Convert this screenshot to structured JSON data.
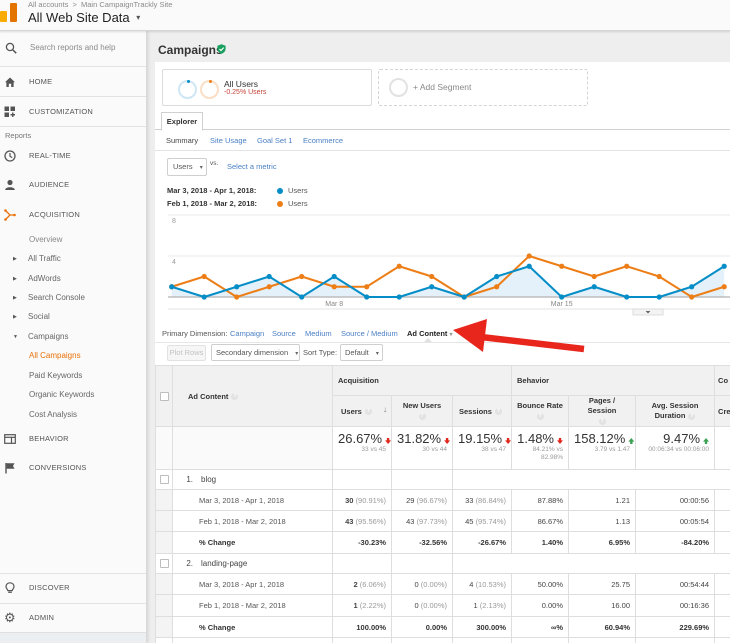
{
  "header": {
    "breadcrumb_account": "All accounts",
    "breadcrumb_separator": ">",
    "breadcrumb_property": "Main CampaignTrackly Site",
    "view_name": "All Web Site Data",
    "view_caret": "▾"
  },
  "sidebar": {
    "search_placeholder": "Search reports and help",
    "home": "HOME",
    "customization": "CUSTOMIZATION",
    "reports_heading": "Reports",
    "realtime": "REAL-TIME",
    "audience": "AUDIENCE",
    "acquisition": "ACQUISITION",
    "acquisition_items": [
      "Overview",
      "All Traffic",
      "AdWords",
      "Search Console",
      "Social",
      "Campaigns"
    ],
    "campaign_items": [
      "All Campaigns",
      "Paid Keywords",
      "Organic Keywords",
      "Cost Analysis"
    ],
    "behavior": "BEHAVIOR",
    "conversions": "CONVERSIONS",
    "discover": "DISCOVER",
    "admin": "ADMIN",
    "active_item": "All Campaigns",
    "accent_color": "#e8710a",
    "expand_glyph": "▶",
    "collapse_glyph": "▼"
  },
  "page": {
    "title": "Campaigns",
    "verified_icon": "shield-check-icon"
  },
  "segments": {
    "active_name": "All Users",
    "active_detail": "-0.25% Users",
    "add_label": "+ Add Segment"
  },
  "explorer": {
    "tab": "Explorer",
    "subtabs": [
      "Summary",
      "Site Usage",
      "Goal Set 1",
      "Ecommerce"
    ],
    "active_subtab": "Summary"
  },
  "metric_picker": {
    "selected": "Users",
    "caret": "▾",
    "vs_label": "vs.",
    "select_metric": "Select a metric"
  },
  "legend": [
    {
      "range": "Mar 3, 2018 - Apr 1, 2018:",
      "metric": "Users",
      "color": "#058dc7"
    },
    {
      "range": "Feb 1, 2018 - Mar 2, 2018:",
      "metric": "Users",
      "color": "#ed7e17"
    }
  ],
  "chart_data": {
    "type": "line",
    "title": "",
    "xlabel": "",
    "ylabel": "",
    "x": [
      "Mar 3",
      "Mar 4",
      "Mar 5",
      "Mar 6",
      "Mar 7",
      "Mar 8",
      "Mar 9",
      "Mar 10",
      "Mar 11",
      "Mar 12",
      "Mar 13",
      "Mar 14",
      "Mar 15",
      "Mar 16",
      "Mar 17",
      "Mar 18",
      "Mar 19",
      "Mar 20"
    ],
    "x_ticks": [
      "Mar 8",
      "Mar 15"
    ],
    "y_ticks": [
      4,
      8
    ],
    "ylim": [
      0,
      8
    ],
    "grid": true,
    "legend": "top-left",
    "series": [
      {
        "name": "Users (Mar 3, 2018 - Apr 1, 2018)",
        "color": "#058dc7",
        "area": true,
        "values": [
          1,
          0,
          1,
          2,
          0,
          2,
          0,
          0,
          1,
          0,
          2,
          3,
          0,
          1,
          0,
          0,
          1,
          3
        ]
      },
      {
        "name": "Users (Feb 1, 2018 - Mar 2, 2018)",
        "color": "#ed7e17",
        "area": false,
        "values": [
          1,
          2,
          0,
          1,
          2,
          1,
          1,
          3,
          2,
          0,
          1,
          4,
          3,
          2,
          3,
          2,
          0,
          1
        ]
      }
    ]
  },
  "dimensions": {
    "label": "Primary Dimension:",
    "options": [
      "Campaign",
      "Source",
      "Medium",
      "Source / Medium"
    ],
    "active": "Ad Content",
    "active_caret": "▾"
  },
  "table_toolbar": {
    "plot_rows": "Plot Rows",
    "secondary_dimension": "Secondary dimension",
    "sort_type_label": "Sort Type:",
    "sort_type_value": "Default",
    "caret": "▾"
  },
  "table": {
    "headers": {
      "dimension": "Ad Content",
      "acquisition": "Acquisition",
      "behavior": "Behavior",
      "conversions_partial": "Co",
      "users": "Users",
      "new_users": "New Users",
      "sessions": "Sessions",
      "bounce_rate": "Bounce Rate",
      "pages_session": "Pages / Session",
      "avg_session_duration": "Avg. Session Duration",
      "conversions_sub_partial": "Cre",
      "help": "?",
      "sort_arrow": "↓"
    },
    "totals": [
      {
        "metric": "Users",
        "value": "26.67%",
        "trend": "down",
        "compare": "33 vs 45"
      },
      {
        "metric": "New Users",
        "value": "31.82%",
        "trend": "down",
        "compare": "30 vs 44"
      },
      {
        "metric": "Sessions",
        "value": "19.15%",
        "trend": "down",
        "compare": "38 vs 47"
      },
      {
        "metric": "Bounce Rate",
        "value": "1.48%",
        "trend": "down",
        "compare": "84.21% vs 82.98%"
      },
      {
        "metric": "Pages / Session",
        "value": "158.12%",
        "trend": "up",
        "compare": "3.79 vs 1.47"
      },
      {
        "metric": "Avg. Session Duration",
        "value": "9.47%",
        "trend": "up",
        "compare": "00:06:34 vs 00:06:00"
      }
    ],
    "trend_colors": {
      "down": "#e0281d",
      "up": "#3ba153"
    },
    "groups": [
      {
        "index": "1.",
        "name": "blog",
        "rows": [
          {
            "label": "Mar 3, 2018 - Apr 1, 2018",
            "users": "30",
            "users_pct": "(90.91%)",
            "new_users": "29",
            "new_users_pct": "(96.67%)",
            "sessions": "33",
            "sessions_pct": "(86.84%)",
            "bounce_rate": "87.88%",
            "pages_session": "1.21",
            "avg_session_duration": "00:00:56"
          },
          {
            "label": "Feb 1, 2018 - Mar 2, 2018",
            "users": "43",
            "users_pct": "(95.56%)",
            "new_users": "43",
            "new_users_pct": "(97.73%)",
            "sessions": "45",
            "sessions_pct": "(95.74%)",
            "bounce_rate": "86.67%",
            "pages_session": "1.13",
            "avg_session_duration": "00:05:54"
          },
          {
            "label": "% Change",
            "users": "-30.23%",
            "new_users": "-32.56%",
            "sessions": "-26.67%",
            "bounce_rate": "1.40%",
            "pages_session": "6.95%",
            "avg_session_duration": "-84.20%"
          }
        ]
      },
      {
        "index": "2.",
        "name": "landing-page",
        "rows": [
          {
            "label": "Mar 3, 2018 - Apr 1, 2018",
            "users": "2",
            "users_pct": "(6.06%)",
            "new_users": "0",
            "new_users_pct": "(0.00%)",
            "sessions": "4",
            "sessions_pct": "(10.53%)",
            "bounce_rate": "50.00%",
            "pages_session": "25.75",
            "avg_session_duration": "00:54:44"
          },
          {
            "label": "Feb 1, 2018 - Mar 2, 2018",
            "users": "1",
            "users_pct": "(2.22%)",
            "new_users": "0",
            "new_users_pct": "(0.00%)",
            "sessions": "1",
            "sessions_pct": "(2.13%)",
            "bounce_rate": "0.00%",
            "pages_session": "16.00",
            "avg_session_duration": "00:16:36"
          },
          {
            "label": "% Change",
            "users": "100.00%",
            "new_users": "0.00%",
            "sessions": "300.00%",
            "bounce_rate": "∞%",
            "pages_session": "60.94%",
            "avg_session_duration": "229.69%"
          }
        ]
      }
    ]
  },
  "annotation": {
    "arrow_color": "#e8261c"
  }
}
